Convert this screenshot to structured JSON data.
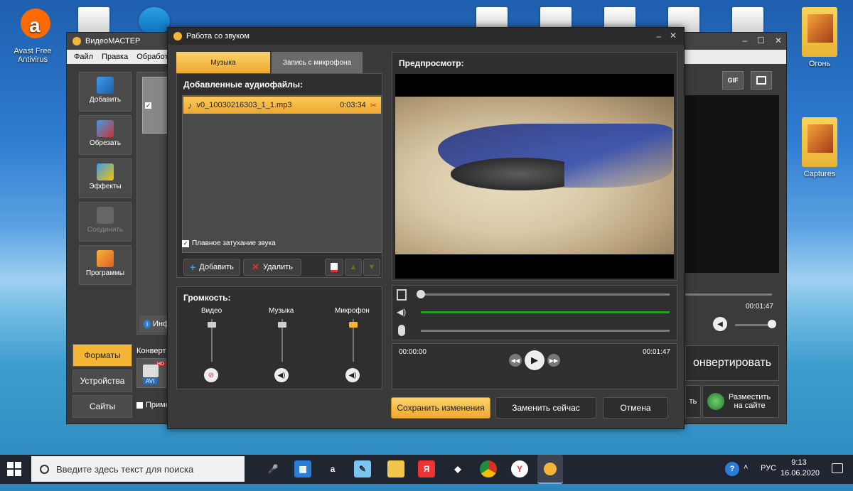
{
  "desktop": {
    "icons": [
      {
        "label": "Avast Free\nAntivirus"
      },
      {
        "label": "Огонь"
      },
      {
        "label": "Captures"
      }
    ]
  },
  "main_window": {
    "title": "ВидеоМАСТЕР",
    "menu": [
      "Файл",
      "Правка",
      "Обработ"
    ],
    "left_buttons": [
      "Добавить",
      "Обрезать",
      "Эффекты",
      "Соединить",
      "Программы"
    ],
    "side_tabs": [
      "Форматы",
      "Устройства",
      "Сайты"
    ],
    "convert_label": "Конверт",
    "format_badge": "AVI",
    "hd_badge": "HD",
    "apply_label": "Приме",
    "info_tab": "Инф",
    "right_time": "00:01:47",
    "convert_button": "онвертировать",
    "t_label": "ть",
    "publish_button": "Разместить\nна сайте",
    "gif_label": "GIF"
  },
  "dialog": {
    "title": "Работа со звуком",
    "tabs": [
      "Музыка",
      "Запись с микрофона"
    ],
    "added_header": "Добавленные аудиофайлы:",
    "audio_files": [
      {
        "name": "v0_10030216303_1_1.mp3",
        "duration": "0:03:34"
      }
    ],
    "fade_label": "Плавное затухание звука",
    "add_button": "Добавить",
    "delete_button": "Удалить",
    "volume_header": "Громкость:",
    "volume_channels": [
      {
        "label": "Видео",
        "level": 0.9
      },
      {
        "label": "Музыка",
        "level": 0.9
      },
      {
        "label": "Микрофон",
        "level": 0.9
      }
    ],
    "preview_header": "Предпросмотр:",
    "time_start": "00:00:00",
    "time_end": "00:01:47",
    "save_button": "Сохранить изменения",
    "replace_button": "Заменить сейчас",
    "cancel_button": "Отмена"
  },
  "taskbar": {
    "search_placeholder": "Введите здесь текст для поиска",
    "language": "РУС",
    "time": "9:13",
    "date": "16.06.2020"
  },
  "colors": {
    "accent": "#f5b636",
    "selected_row": "#f0a830",
    "music_track": "#23a023"
  }
}
